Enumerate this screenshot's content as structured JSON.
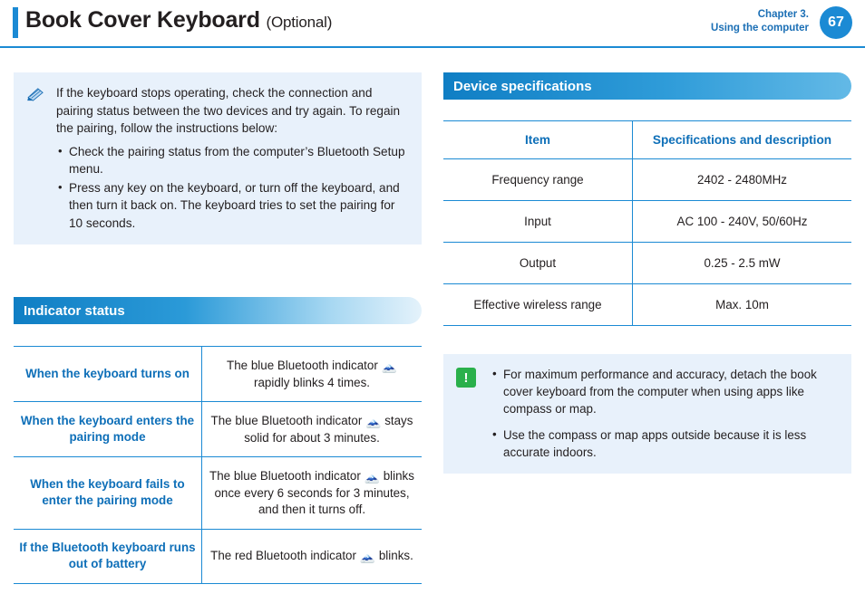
{
  "header": {
    "title": "Book Cover Keyboard",
    "title_suffix": "(Optional)",
    "chapter_line1": "Chapter 3.",
    "chapter_line2": "Using the computer",
    "page_number": "67",
    "accent_color": "#1b8ad4"
  },
  "note": {
    "icon": "pencil-note-icon",
    "paragraph": "If the keyboard stops operating, check the connection and pairing status between the two devices and try again. To regain the pairing, follow the instructions below:",
    "bullets": [
      "Check the pairing status from the computer’s Bluetooth Setup menu.",
      "Press any key on the keyboard, or turn off the keyboard, and then turn it back on. The keyboard tries to set the pairing for 10 seconds."
    ]
  },
  "indicator_section": {
    "heading": "Indicator status",
    "rows": [
      {
        "label": "When the keyboard turns on",
        "text_before": "The blue Bluetooth indicator",
        "glyph": "bluetooth-icon",
        "glyph_color": "blue",
        "text_after": "rapidly blinks 4 times."
      },
      {
        "label": "When the keyboard enters the pairing mode",
        "text_before": "The blue Bluetooth indicator",
        "glyph": "bluetooth-icon",
        "glyph_color": "blue",
        "text_after": "stays solid for about 3 minutes."
      },
      {
        "label": "When the keyboard fails to enter the pairing mode",
        "text_before": "The blue Bluetooth indicator",
        "glyph": "bluetooth-icon",
        "glyph_color": "blue",
        "text_after": "blinks once every 6 seconds for 3 minutes, and then it turns off."
      },
      {
        "label": "If the Bluetooth keyboard runs out of battery",
        "text_before": "The red Bluetooth indicator",
        "glyph": "bluetooth-icon",
        "glyph_color": "red",
        "text_after": "blinks."
      }
    ]
  },
  "spec_section": {
    "heading": "Device specifications",
    "columns": [
      "Item",
      "Specifications and description"
    ],
    "rows": [
      {
        "item": "Frequency range",
        "value": "2402 - 2480MHz"
      },
      {
        "item": "Input",
        "value": "AC 100 - 240V, 50/60Hz"
      },
      {
        "item": "Output",
        "value": "0.25 - 2.5 mW"
      },
      {
        "item": "Effective wireless range",
        "value": "Max. 10m"
      }
    ]
  },
  "caution": {
    "icon": "exclamation-icon",
    "icon_color": "#2ab04b",
    "bullets": [
      "For maximum performance and accuracy, detach the book cover keyboard from the computer when using apps like compass or map.",
      "Use the compass or map apps outside because it is less accurate indoors."
    ]
  }
}
